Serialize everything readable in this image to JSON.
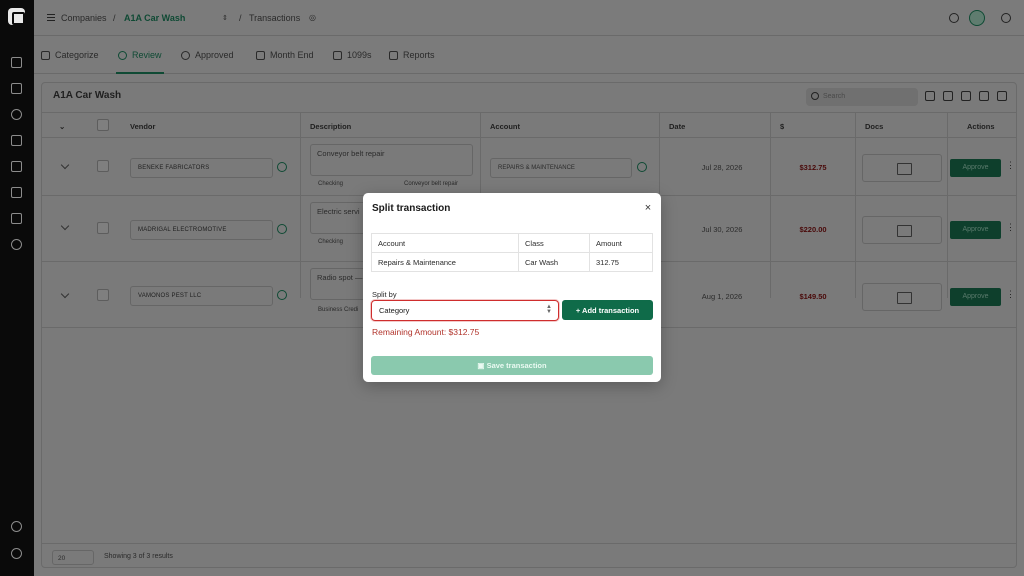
{
  "breadcrumb": {
    "root": "Companies",
    "company": "A1A Car Wash",
    "separator": "/",
    "page": "Transactions"
  },
  "tabs": [
    {
      "label": "Categorize"
    },
    {
      "label": "Review"
    },
    {
      "label": "Approved"
    },
    {
      "label": "Month End"
    },
    {
      "label": "1099s"
    },
    {
      "label": "Reports"
    }
  ],
  "card": {
    "title": "A1A Car Wash",
    "search_placeholder": "Search"
  },
  "table": {
    "headers": {
      "vendor": "Vendor",
      "description": "Description",
      "account": "Account",
      "date": "Date",
      "amount": "$",
      "docs": "Docs",
      "actions": "Actions"
    },
    "rows": [
      {
        "vendor": "BENEKE FABRICATORS",
        "description": "Conveyor belt repair",
        "bank": "Checking",
        "memo": "Conveyor belt repair",
        "account": "REPAIRS & MAINTENANCE",
        "date": "Jul 28, 2026",
        "amount": "$312.75",
        "action": "Approve"
      },
      {
        "vendor": "MADRIGAL ELECTROMOTIVE",
        "description": "Electric servi",
        "bank": "Checking",
        "memo": "",
        "account": "",
        "date": "Jul 30, 2026",
        "amount": "$220.00",
        "action": "Approve"
      },
      {
        "vendor": "VAMONOS PEST LLC",
        "description": "Radio spot —",
        "bank": "Business Credi",
        "memo": "",
        "account": "",
        "date": "Aug 1, 2026",
        "amount": "$149.50",
        "action": "Approve"
      }
    ]
  },
  "footer": {
    "page_size": "20",
    "showing": "Showing 3 of 3 results"
  },
  "modal": {
    "title": "Split transaction",
    "close": "×",
    "table_headers": [
      "Account",
      "Class",
      "Amount"
    ],
    "table_row": [
      "Repairs & Maintenance",
      "Car Wash",
      "312.75"
    ],
    "split_by_label": "Split by",
    "split_by_value": "Category",
    "add_button": "+  Add transaction",
    "remaining": "Remaining Amount: $312.75",
    "save_button": "Save transaction"
  },
  "colors": {
    "accent": "#0f6b49",
    "danger": "#b1332b",
    "save_disabled": "#8ac9ae"
  }
}
